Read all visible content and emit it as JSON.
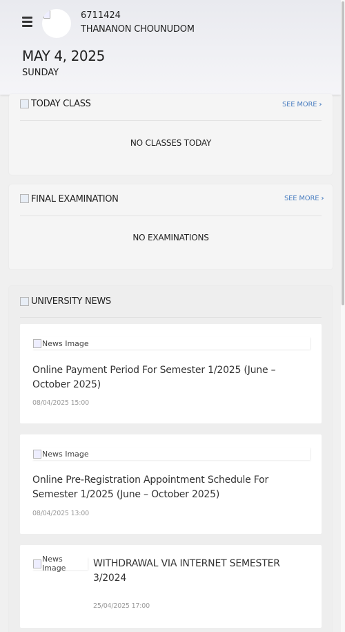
{
  "header": {
    "student_id": "6711424",
    "student_name": "THANANON CHOUNUDOM",
    "date": "MAY 4, 2025",
    "day": "SUNDAY"
  },
  "today_class": {
    "title": "TODAY CLASS",
    "see_more": "SEE MORE",
    "empty": "NO CLASSES TODAY"
  },
  "final_exam": {
    "title": "FINAL EXAMINATION",
    "see_more": "SEE MORE",
    "empty": "NO EXAMINATIONS"
  },
  "news": {
    "title": "UNIVERSITY NEWS",
    "image_alt": "News Image",
    "items": [
      {
        "title": "Online Payment Period For Semester 1/2025 (June – October 2025)",
        "date": "08/04/2025 15:00"
      },
      {
        "title": "Online Pre-Registration Appointment Schedule For Semester 1/2025 (June – October 2025)",
        "date": "08/04/2025 13:00"
      },
      {
        "title": "WITHDRAWAL VIA INTERNET SEMESTER 3/2024",
        "date": "25/04/2025 17:00"
      }
    ]
  }
}
